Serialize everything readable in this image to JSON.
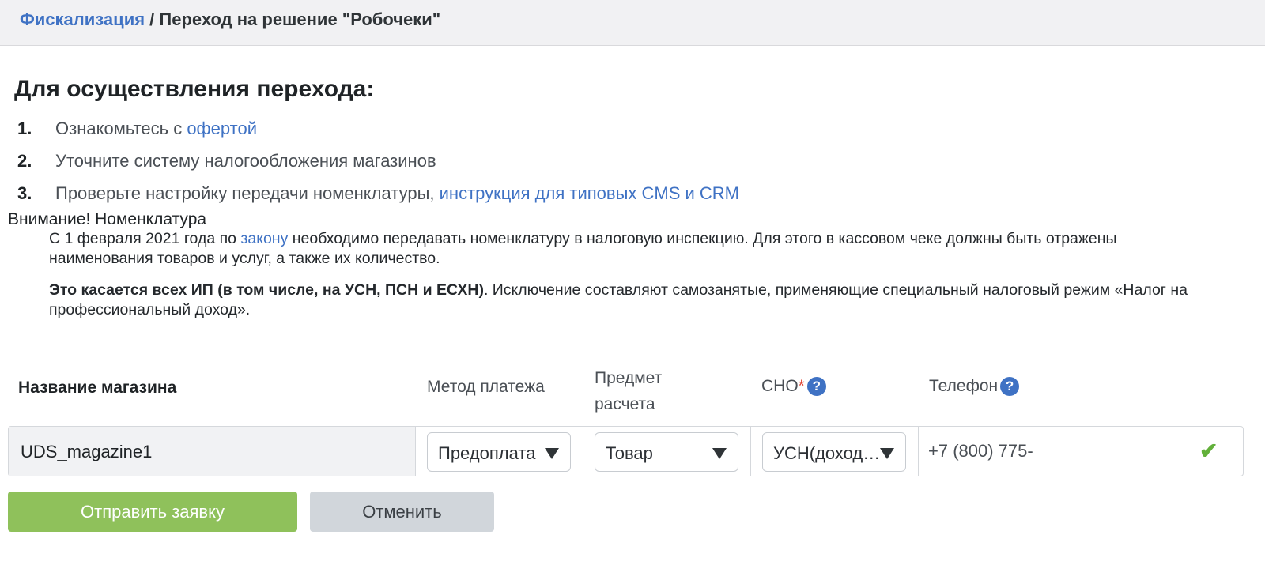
{
  "breadcrumb": {
    "root_label": "Фискализация",
    "separator": " / ",
    "current_label": "Переход на решение \"Робочеки\""
  },
  "page_title": "Для осуществления перехода:",
  "steps": [
    {
      "num": "1.",
      "text": "Ознакомьтесь с ",
      "link": "офертой"
    },
    {
      "num": "2.",
      "text": "Уточните систему налогообложения магазинов",
      "link": ""
    },
    {
      "num": "3.",
      "text": "Проверьте настройку передачи номенклатуры, ",
      "link": "инструкция для типовых CMS и CRM"
    }
  ],
  "warning": {
    "title": "Внимание! Номенклатура",
    "p1_before": "С 1 февраля 2021 года по ",
    "p1_link": "закону",
    "p1_after": " необходимо передавать номенклатуру в налоговую инспекцию. Для этого в кассовом чеке должны быть отражены наименования товаров и услуг, а также их количество.",
    "p2_bold": "Это касается всех ИП (в том числе, на УСН, ПСН и ЕСХН)",
    "p2_after": ". Исключение составляют самозанятые, применяющие специальный налоговый режим «Налог на профессиональный доход»."
  },
  "table": {
    "headers": {
      "shop_name": "Название магазина",
      "payment_method": "Метод платежа",
      "subject_line1": "Предмет",
      "subject_line2": "расчета",
      "sno": "СНО",
      "sno_required": "*",
      "phone": "Телефон",
      "help_glyph": "?"
    },
    "row": {
      "shop_name": "UDS_magazine1",
      "payment_method": "Предоплата",
      "subject": "Товар",
      "sno": "УСН(доходы)",
      "phone": "+7 (800) 775-",
      "phone_placeholder": "+7 (800) 775-",
      "confirm_glyph": "✔"
    }
  },
  "buttons": {
    "submit": "Отправить заявку",
    "cancel": "Отменить"
  },
  "colors": {
    "link": "#3f72c4",
    "submit_bg": "#8fc15b",
    "cancel_bg": "#d1d6db",
    "required": "#e0402f",
    "check": "#62b03a",
    "topbar_bg": "#f1f1f3"
  },
  "icons": {
    "help": "question-circle-icon",
    "confirm": "checkmark-icon",
    "dropdown": "caret-down-icon"
  }
}
